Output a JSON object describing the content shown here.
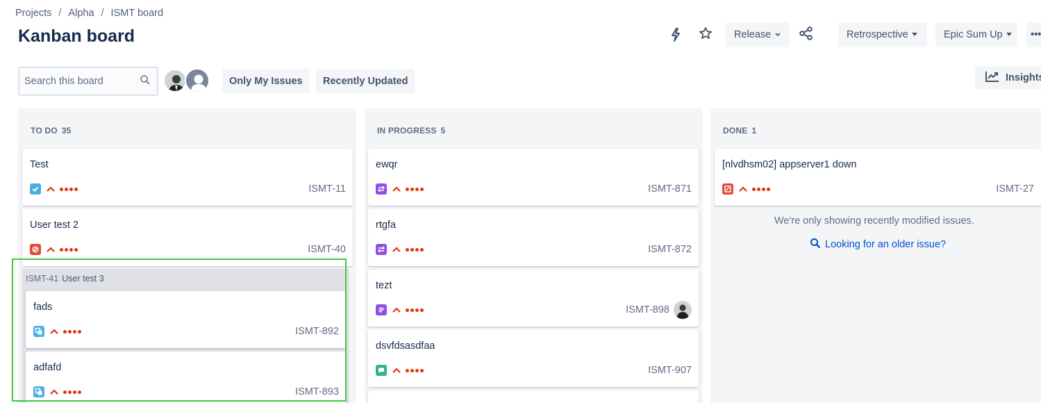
{
  "breadcrumb": {
    "items": [
      "Projects",
      "Alpha",
      "ISMT board"
    ],
    "separator": "/"
  },
  "page_title": "Kanban board",
  "toolbar": {
    "release_label": "Release",
    "retrospective_label": "Retrospective",
    "epic_sum_up_label": "Epic Sum Up",
    "more_label": "•••",
    "insights_label": "Insights"
  },
  "search": {
    "placeholder": "Search this board"
  },
  "filters": {
    "only_my_issues": "Only My Issues",
    "recently_updated": "Recently Updated"
  },
  "columns": [
    {
      "name": "TO DO",
      "count": "35",
      "cards": [
        {
          "title": "Test",
          "key": "ISMT-11",
          "type": "task-icon",
          "type_color": "#4bade8"
        },
        {
          "title": "User test 2",
          "key": "ISMT-40",
          "type": "bug-icon",
          "type_color": "#e5493a"
        }
      ],
      "group": {
        "key": "ISMT-41",
        "title": "User test 3",
        "cards": [
          {
            "title": "fads",
            "key": "ISMT-892",
            "type": "subtask-icon",
            "type_color": "#4bade8"
          },
          {
            "title": "adfafd",
            "key": "ISMT-893",
            "type": "subtask-icon",
            "type_color": "#4bade8"
          }
        ]
      }
    },
    {
      "name": "IN PROGRESS",
      "count": "5",
      "cards": [
        {
          "title": "ewqr",
          "key": "ISMT-871",
          "type": "change-icon",
          "type_color": "#904ee2"
        },
        {
          "title": "rtgfa",
          "key": "ISMT-872",
          "type": "change-icon",
          "type_color": "#904ee2"
        },
        {
          "title": "tezt",
          "key": "ISMT-898",
          "type": "story-icon",
          "type_color": "#904ee2"
        },
        {
          "title": "dsvfdsasdfaa",
          "key": "ISMT-907",
          "type": "comment-icon",
          "type_color": "#36b37e"
        }
      ]
    },
    {
      "name": "DONE",
      "count": "1",
      "cards": [
        {
          "title": "[nlvdhsm02] appserver1 down",
          "key": "ISMT-27",
          "type": "incident-icon",
          "type_color": "#e5493a"
        }
      ],
      "message": "We're only showing recently modified issues.",
      "link": "Looking for an older issue?"
    }
  ],
  "colors": {
    "priority": "#de350b",
    "selection": "#3ec93e",
    "link": "#0052cc"
  }
}
